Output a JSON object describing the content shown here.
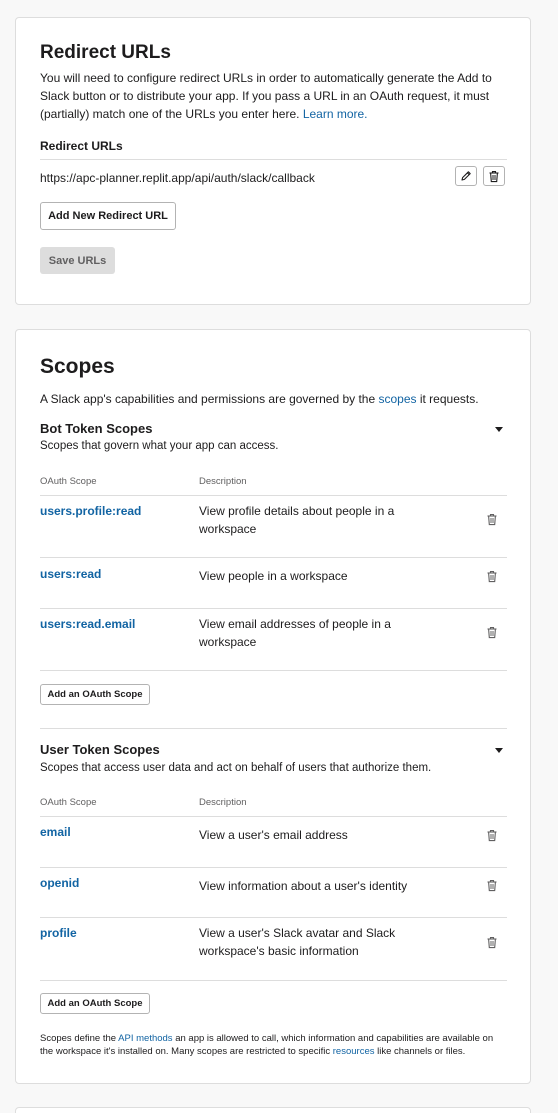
{
  "redirect": {
    "title": "Redirect URLs",
    "description": "You will need to configure redirect URLs in order to automatically generate the Add to Slack button or to distribute your app. If you pass a URL in an OAuth request, it must (partially) match one of the URLs you enter here.",
    "learn_more": "Learn more.",
    "list_label": "Redirect URLs",
    "url": "https://apc-planner.replit.app/api/auth/slack/callback",
    "add_button": "Add New Redirect URL",
    "save_button": "Save URLs"
  },
  "scopes": {
    "title": "Scopes",
    "intro_prefix": "A Slack app's capabilities and permissions are governed by the ",
    "intro_link": "scopes",
    "intro_suffix": " it requests.",
    "bot": {
      "title": "Bot Token Scopes",
      "subtitle": "Scopes that govern what your app can access.",
      "col_scope": "OAuth Scope",
      "col_desc": "Description",
      "rows": [
        {
          "name": "users.profile:read",
          "desc": "View profile details about people in a workspace"
        },
        {
          "name": "users:read",
          "desc": "View people in a workspace"
        },
        {
          "name": "users:read.email",
          "desc": "View email addresses of people in a workspace"
        }
      ],
      "add_button": "Add an OAuth Scope"
    },
    "user": {
      "title": "User Token Scopes",
      "subtitle": "Scopes that access user data and act on behalf of users that authorize them.",
      "col_scope": "OAuth Scope",
      "col_desc": "Description",
      "rows": [
        {
          "name": "email",
          "desc": "View a user's email address"
        },
        {
          "name": "openid",
          "desc": "View information about a user's identity"
        },
        {
          "name": "profile",
          "desc": "View a user's Slack avatar and Slack workspace's basic information"
        }
      ],
      "add_button": "Add an OAuth Scope"
    },
    "footer": {
      "part1": "Scopes define the ",
      "link1": "API methods",
      "part2": " an app is allowed to call, which information and capabilities are available on the workspace it's installed on. Many scopes are restricted to specific ",
      "link2": "resources",
      "part3": " like channels or files."
    }
  },
  "icons": {
    "edit": "pencil-icon",
    "delete": "trash-icon",
    "collapse": "caret-down-icon"
  },
  "colors": {
    "link": "#1264a3",
    "border": "#dddddd",
    "background": "#f8f8f8"
  }
}
